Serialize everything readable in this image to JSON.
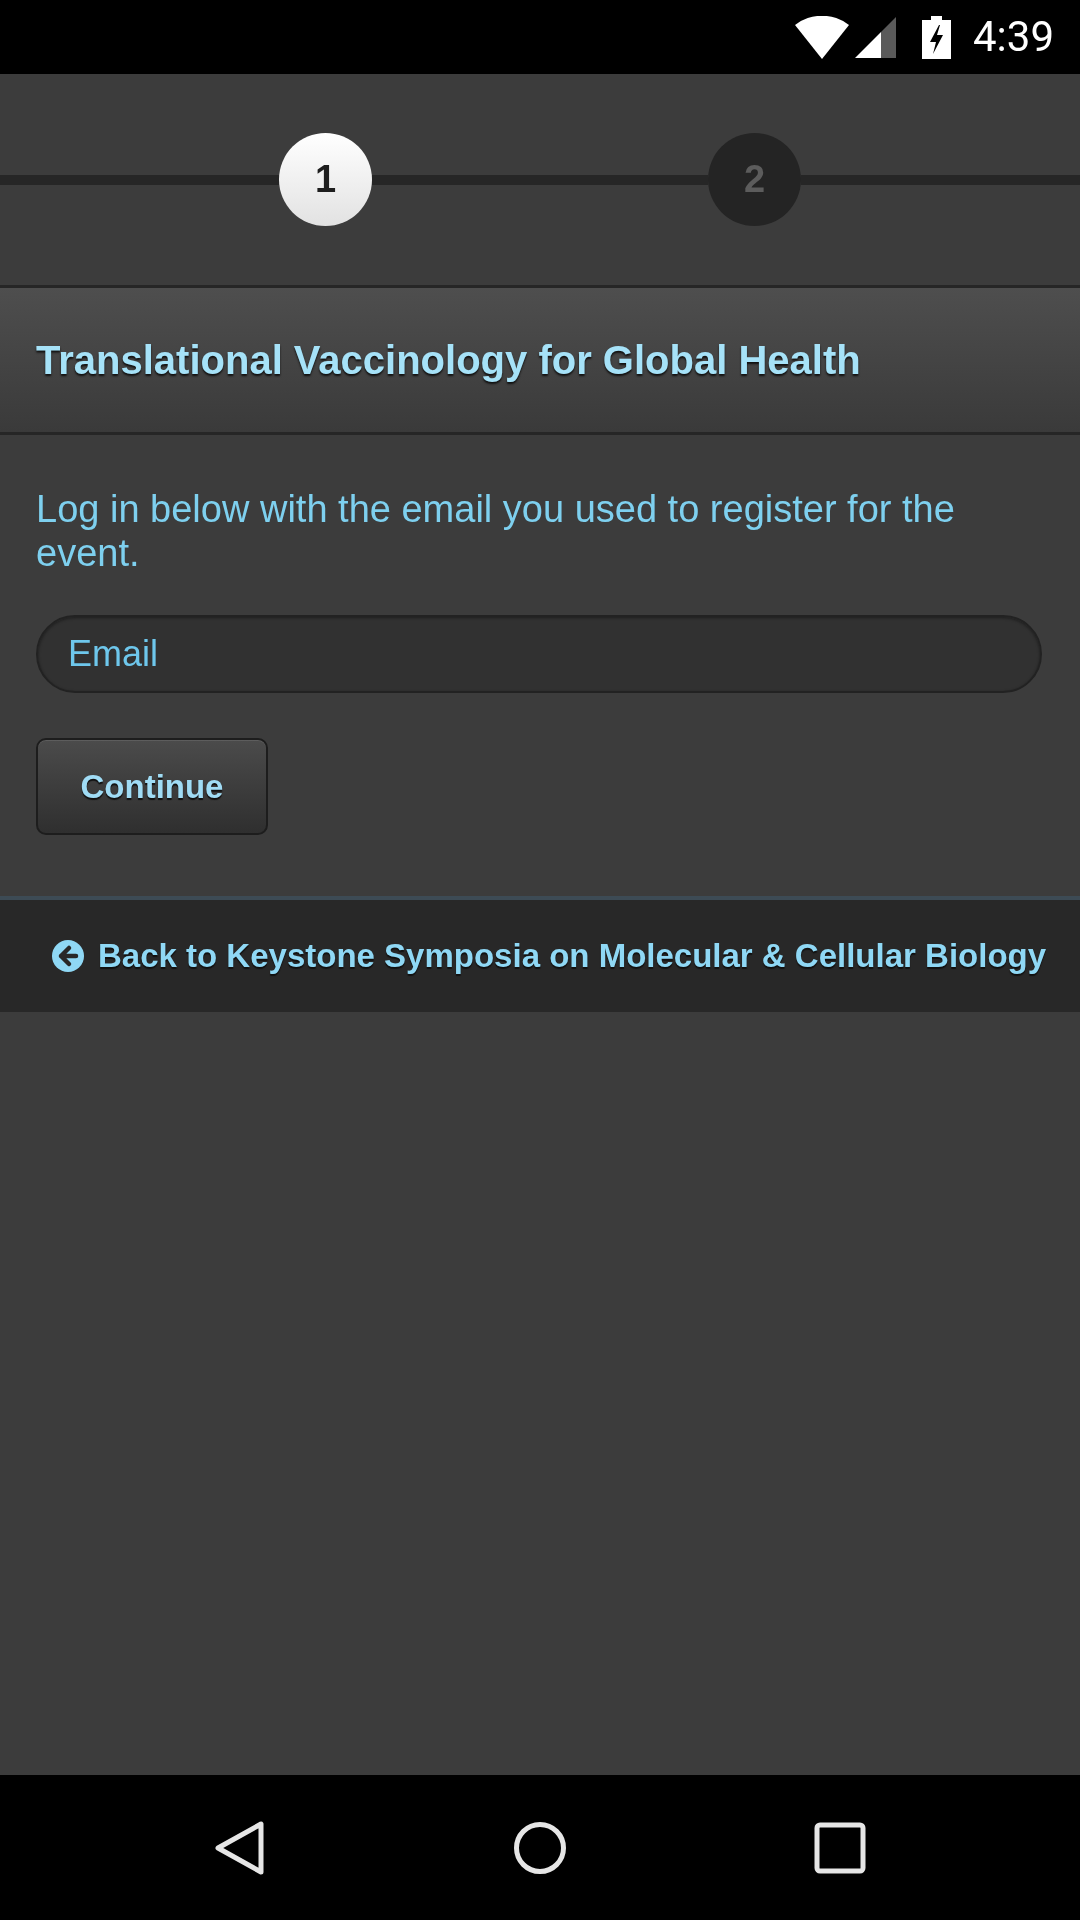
{
  "status_bar": {
    "time": "4:39"
  },
  "stepper": {
    "steps": [
      {
        "label": "1",
        "selected": true
      },
      {
        "label": "2",
        "selected": false
      }
    ]
  },
  "header": {
    "title": "Translational Vaccinology for Global Health"
  },
  "login": {
    "instructions": "Log in below with the email you used to register for the event.",
    "email_field": {
      "placeholder": "Email"
    },
    "continue_button": "Continue"
  },
  "back_link": {
    "label": "Back to Keystone Symposia on Molecular & Cellular Biology"
  }
}
